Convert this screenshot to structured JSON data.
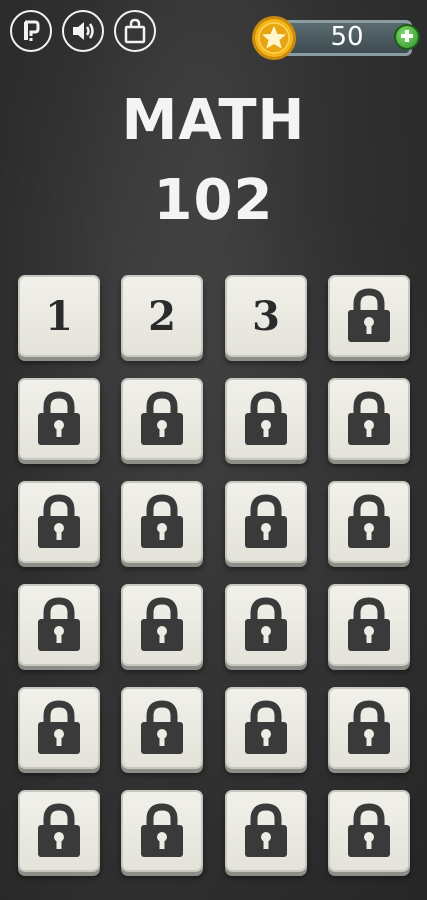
{
  "toolbar": {
    "help_icon": "help-icon",
    "sound_icon": "sound-icon",
    "shop_icon": "shopping-bag-icon"
  },
  "coins": {
    "value": "50",
    "icon": "star-coin-icon",
    "add_icon": "plus-icon"
  },
  "title": {
    "line1": "MATH",
    "line2": "102"
  },
  "levels": [
    {
      "label": "1",
      "locked": false
    },
    {
      "label": "2",
      "locked": false
    },
    {
      "label": "3",
      "locked": false
    },
    {
      "label": "",
      "locked": true
    },
    {
      "label": "",
      "locked": true
    },
    {
      "label": "",
      "locked": true
    },
    {
      "label": "",
      "locked": true
    },
    {
      "label": "",
      "locked": true
    },
    {
      "label": "",
      "locked": true
    },
    {
      "label": "",
      "locked": true
    },
    {
      "label": "",
      "locked": true
    },
    {
      "label": "",
      "locked": true
    },
    {
      "label": "",
      "locked": true
    },
    {
      "label": "",
      "locked": true
    },
    {
      "label": "",
      "locked": true
    },
    {
      "label": "",
      "locked": true
    },
    {
      "label": "",
      "locked": true
    },
    {
      "label": "",
      "locked": true
    },
    {
      "label": "",
      "locked": true
    },
    {
      "label": "",
      "locked": true
    },
    {
      "label": "",
      "locked": true
    },
    {
      "label": "",
      "locked": true
    },
    {
      "label": "",
      "locked": true
    },
    {
      "label": "",
      "locked": true
    }
  ],
  "colors": {
    "background": "#303030",
    "tile": "#ecebe4",
    "lock": "#3a3a3a",
    "coin": "#f5b61a",
    "plus": "#3faa35"
  }
}
